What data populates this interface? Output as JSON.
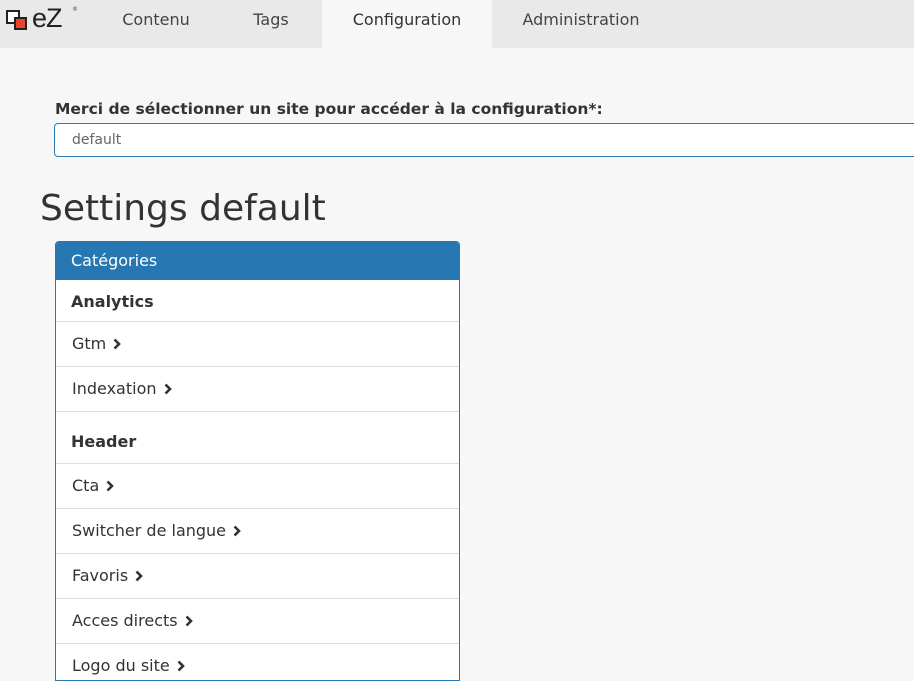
{
  "logo": {
    "text": "eZ",
    "mark": "®"
  },
  "nav": {
    "tabs": [
      {
        "label": "Contenu"
      },
      {
        "label": "Tags"
      },
      {
        "label": "Configuration"
      },
      {
        "label": "Administration"
      }
    ],
    "active_tab": "Configuration"
  },
  "site_selector": {
    "label": "Merci de sélectionner un site pour accéder à la configuration*:",
    "value": "default"
  },
  "page_title": "Settings default",
  "categories": {
    "header": "Catégories",
    "groups": [
      {
        "title": "Analytics",
        "items": [
          {
            "label": "Gtm"
          },
          {
            "label": "Indexation"
          }
        ]
      },
      {
        "title": "Header",
        "items": [
          {
            "label": "Cta"
          },
          {
            "label": "Switcher de langue"
          },
          {
            "label": "Favoris"
          },
          {
            "label": "Acces directs"
          },
          {
            "label": "Logo du site"
          }
        ]
      }
    ]
  },
  "icons": {
    "chevron": "chevron-right-icon"
  },
  "colors": {
    "accent": "#2677b2",
    "logo_red": "#e8452c"
  }
}
